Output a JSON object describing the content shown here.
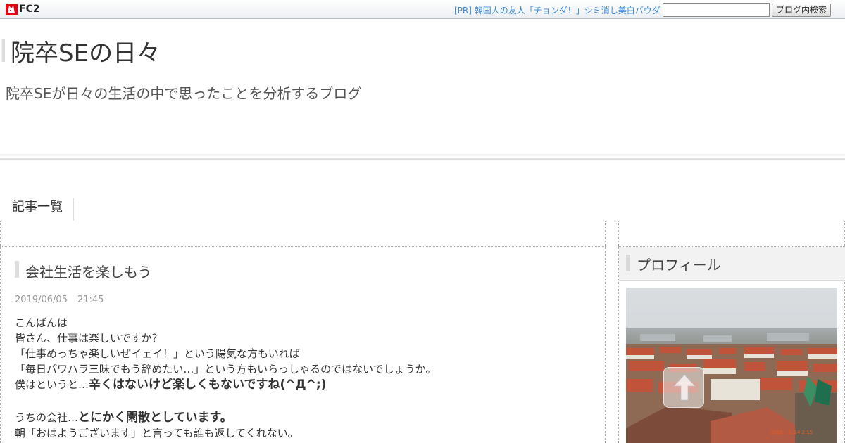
{
  "topbar": {
    "logo_text": "FC2",
    "pr_link": "[PR] 韓国人の友人「チョンダ！」シミ消し美白パウダ",
    "search_placeholder": "",
    "search_button": "ブログ内検索"
  },
  "header": {
    "title": "院卒SEの日々",
    "description": "院卒SEが日々の生活の中で思ったことを分析するブログ"
  },
  "nav": {
    "items": [
      {
        "label": "記事一覧"
      }
    ]
  },
  "entry": {
    "title": "会社生活を楽しもう",
    "date": "2019/06/05",
    "time": "21:45",
    "body": {
      "l1": "こんばんは",
      "l2": "皆さん、仕事は楽しいですか？",
      "l3": "「仕事めっちゃ楽しいぜイェイ！」という陽気な方もいれば",
      "l4": "「毎日パワハラ三昧でもう辞めたい…」という方もいらっしゃるのではないでしょうか。",
      "l5_plain": "僕はというと…",
      "l5_bold": "辛くはないけど楽しくもないですね(^Д^;)",
      "l6_plain": "うちの会社…",
      "l6_bold": "とにかく閑散としています。",
      "l7": "朝「おはようございます」と言っても誰も返してくれない。"
    }
  },
  "sidebar": {
    "profile_title": "プロフィール",
    "photo_timestamp": "2016 .  3 .14    2:15"
  },
  "colors": {
    "link": "#3b8bd6",
    "accent_mark": "#dedede",
    "fc2_logo_red": "#e60012"
  }
}
